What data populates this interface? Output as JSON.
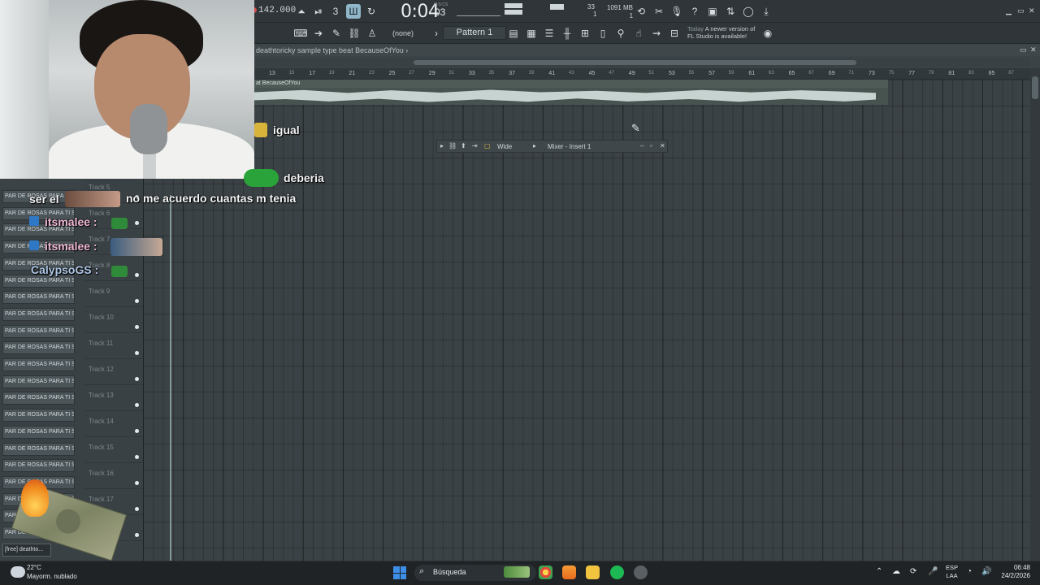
{
  "toolbar": {
    "tempo": "142.000",
    "time_main": "0:04",
    "time_cs": "03",
    "time_label": "M:S:CS",
    "cpu_value": "33",
    "cpu_voices": "1",
    "memory": "1091 MB",
    "memory_sub": "1",
    "none_label": "(none)",
    "pattern": "Pattern 1",
    "news_today": "Today",
    "news_line1": "A newer version of",
    "news_line2": "FL Studio is available!"
  },
  "playlist": {
    "breadcrumb": "deathtoricky  sample type beat BecauseOfYou ›",
    "ruler": [
      "13",
      "17",
      "21",
      "25",
      "29",
      "33",
      "37",
      "41",
      "45",
      "49",
      "53",
      "57",
      "61",
      "65",
      "69",
      "73",
      "77",
      "81",
      "85"
    ],
    "ruler_minor": [
      "15",
      "19",
      "23",
      "27",
      "31",
      "35",
      "39",
      "43",
      "47",
      "51",
      "55",
      "59",
      "63",
      "67",
      "71",
      "75",
      "79",
      "83",
      "87"
    ],
    "clip_name": "at BecauseOfYou",
    "tracks": [
      "Track 5",
      "Track 6",
      "Track 7",
      "Track 8",
      "Track 9",
      "Track 10",
      "Track 11",
      "Track 12",
      "Track 13",
      "Track 14",
      "Track 15",
      "Track 16",
      "Track 17",
      "Track 18"
    ]
  },
  "picker": {
    "items": [
      "PAR DE ROSAS PARA TI SI",
      "PAR DE ROSAS PARA TI SA...",
      "PAR DE ROSAS PARA TI SA...",
      "PAR DE ROSAS PARA TI SA...",
      "PAR DE ROSAS PARA TI SA...",
      "PAR DE ROSAS PARA TI SA...",
      "PAR DE ROSAS PARA TI SA...",
      "PAR DE ROSAS PARA TI SA...",
      "PAR DE ROSAS PARA TI SA...",
      "PAR DE ROSAS PARA TI SA...",
      "PAR DE ROSAS PARA TI SA...",
      "PAR DE ROSAS PARA TI SA...",
      "PAR DE ROSAS PARA TI SA...",
      "PAR DE ROSAS PARA TI SA...",
      "PAR DE ROSAS PARA TI SA...",
      "PAR DE ROSAS PARA TI SA...",
      "PAR DE ROSAS PARA TI SA...",
      "PAR DE ROSAS PARA TI SA...",
      "PAR DE ROSAS PARA TI SA...",
      "PAR DE ROSAS PARA TI SA...",
      "PAR DE ROSAS PARA TI SA..."
    ],
    "last": "[free] deathto..."
  },
  "mixer": {
    "wide": "Wide",
    "title": "Mixer - Insert 1"
  },
  "chat": {
    "msg_igual": "igual",
    "msg_deberia": "deberia",
    "msg_ser": "ser el",
    "msg_acuerdo": "no me acuerdo cuantas m tenia",
    "user1": "itsmalee :",
    "user2": "itsmalee :",
    "user3": "CalypsoGS :"
  },
  "taskbar": {
    "temp": "22°C",
    "weather": "Mayorm. nublado",
    "search": "Búsqueda",
    "lang1": "ESP",
    "lang2": "LAA",
    "time": "06:48",
    "date": "24/2/2026"
  },
  "colors": {
    "accent": "#8fb6c9",
    "record_dot": "#d24a4a"
  }
}
